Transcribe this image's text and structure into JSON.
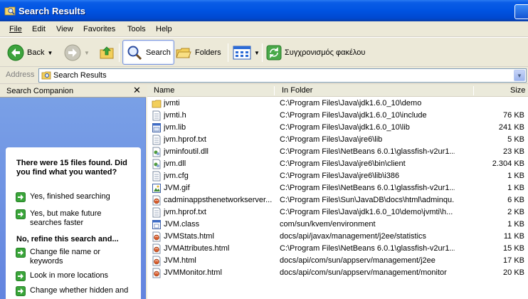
{
  "window": {
    "title": "Search Results"
  },
  "menu": [
    {
      "label": "File"
    },
    {
      "label": "Edit"
    },
    {
      "label": "View"
    },
    {
      "label": "Favorites"
    },
    {
      "label": "Tools"
    },
    {
      "label": "Help"
    }
  ],
  "toolbar": {
    "back_label": "Back",
    "search_label": "Search",
    "folders_label": "Folders",
    "sync_label": "Συγχρονισμός φακέλου"
  },
  "address": {
    "label": "Address",
    "value": "Search Results"
  },
  "companion": {
    "title": "Search Companion",
    "close_symbol": "✕",
    "found_text": "There were 15 files found. Did you find what you wanted?",
    "refine_text": "No, refine this search and...",
    "options_found": [
      {
        "label": "Yes, finished searching"
      },
      {
        "label": "Yes, but make future searches faster"
      }
    ],
    "options_refine": [
      {
        "label": "Change file name or keywords"
      },
      {
        "label": "Look in more locations"
      },
      {
        "label": "Change whether hidden and"
      }
    ]
  },
  "columns": {
    "name": "Name",
    "folder": "In Folder",
    "size": "Size"
  },
  "files": [
    {
      "name": "jvmti",
      "folder": "C:\\Program Files\\Java\\jdk1.6.0_10\\demo",
      "size": "",
      "icon": "folder-icon"
    },
    {
      "name": "jvmti.h",
      "folder": "C:\\Program Files\\Java\\jdk1.6.0_10\\include",
      "size": "76 KB",
      "icon": "text-file-icon"
    },
    {
      "name": "jvm.lib",
      "folder": "C:\\Program Files\\Java\\jdk1.6.0_10\\lib",
      "size": "241 KB",
      "icon": "lib-file-icon"
    },
    {
      "name": "jvm.hprof.txt",
      "folder": "C:\\Program Files\\Java\\jre6\\lib",
      "size": "5 KB",
      "icon": "text-file-icon"
    },
    {
      "name": "jvminfoutil.dll",
      "folder": "C:\\Program Files\\NetBeans 6.0.1\\glassfish-v2ur1...",
      "size": "23 KB",
      "icon": "dll-file-icon"
    },
    {
      "name": "jvm.dll",
      "folder": "C:\\Program Files\\Java\\jre6\\bin\\client",
      "size": "2.304 KB",
      "icon": "dll-file-icon"
    },
    {
      "name": "jvm.cfg",
      "folder": "C:\\Program Files\\Java\\jre6\\lib\\i386",
      "size": "1 KB",
      "icon": "text-file-icon"
    },
    {
      "name": "JVM.gif",
      "folder": "C:\\Program Files\\NetBeans 6.0.1\\glassfish-v2ur1...",
      "size": "1 KB",
      "icon": "image-file-icon"
    },
    {
      "name": "cadminappsthenetworkserver...",
      "folder": "C:\\Program Files\\Sun\\JavaDB\\docs\\html\\adminqu...",
      "size": "6 KB",
      "icon": "html-file-icon"
    },
    {
      "name": "jvm.hprof.txt",
      "folder": "C:\\Program Files\\Java\\jdk1.6.0_10\\demo\\jvmti\\h...",
      "size": "2 KB",
      "icon": "text-file-icon"
    },
    {
      "name": "JVM.class",
      "folder": "com/sun/kvem/environment",
      "size": "1 KB",
      "icon": "class-file-icon"
    },
    {
      "name": "JVMStats.html",
      "folder": "docs/api/javax/management/j2ee/statistics",
      "size": "11 KB",
      "icon": "html-file-icon"
    },
    {
      "name": "JVMAttributes.html",
      "folder": "C:\\Program Files\\NetBeans 6.0.1\\glassfish-v2ur1...",
      "size": "15 KB",
      "icon": "html-file-icon"
    },
    {
      "name": "JVM.html",
      "folder": "docs/api/com/sun/appserv/management/j2ee",
      "size": "17 KB",
      "icon": "html-file-icon"
    },
    {
      "name": "JVMMonitor.html",
      "folder": "docs/api/com/sun/appserv/management/monitor",
      "size": "20 KB",
      "icon": "html-file-icon"
    }
  ]
}
